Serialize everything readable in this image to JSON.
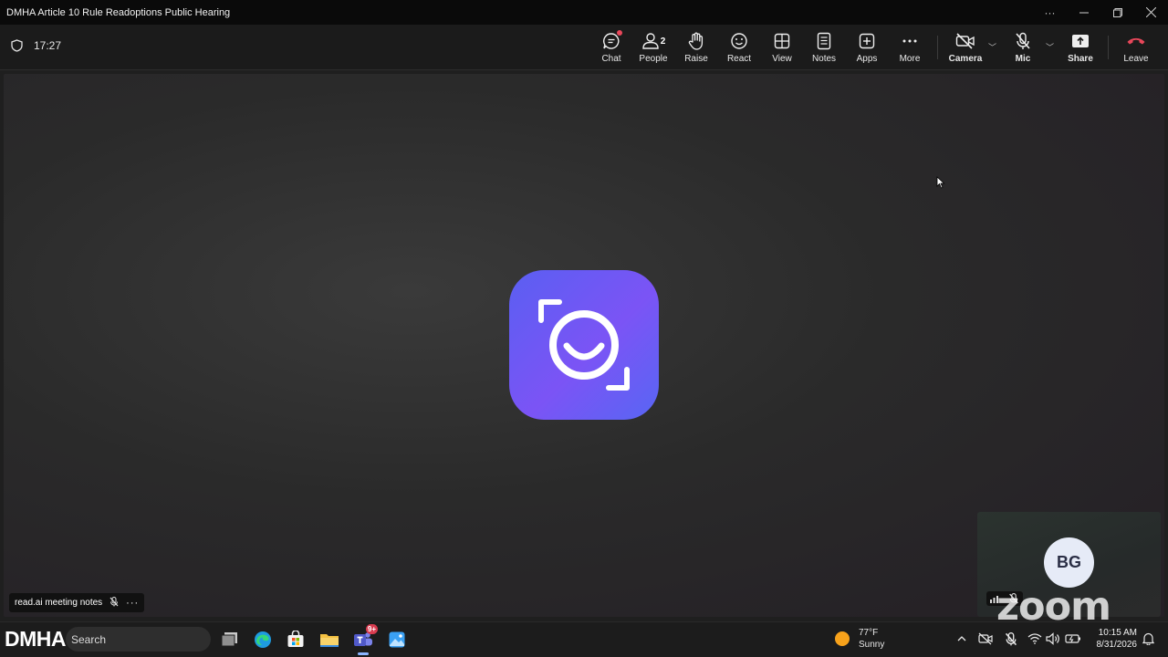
{
  "window": {
    "title": "DMHA Article 10 Rule Readoptions Public Hearing",
    "controls": [
      "more-icon",
      "minimize-icon",
      "restore-icon",
      "close-icon"
    ]
  },
  "toolbar": {
    "timer": "17:27",
    "buttons": {
      "chat": "Chat",
      "people": "People",
      "people_count": "2",
      "raise": "Raise",
      "react": "React",
      "view": "View",
      "notes": "Notes",
      "apps": "Apps",
      "more": "More",
      "camera": "Camera",
      "mic": "Mic",
      "share": "Share",
      "leave": "Leave"
    },
    "colors": {
      "leave": "#e8475a",
      "badge": "#e8475a"
    }
  },
  "stage": {
    "app_logo": "read-ai-logo",
    "logo_color": "#6a5af5",
    "participant_tile": {
      "name": "read.ai meeting notes",
      "muted": true
    }
  },
  "self_view": {
    "initials": "BG",
    "watermark": "zoom"
  },
  "taskbar": {
    "brand": "DMHA",
    "search_placeholder": "Search",
    "apps": [
      "task-view-icon",
      "edge-icon",
      "store-icon",
      "file-explorer-icon",
      "teams-icon",
      "photos-icon"
    ],
    "teams_badge": "9+",
    "weather": {
      "temp": "77°F",
      "condition": "Sunny"
    },
    "clock": {
      "time": "10:15 AM",
      "date": "8/31/2026"
    }
  }
}
